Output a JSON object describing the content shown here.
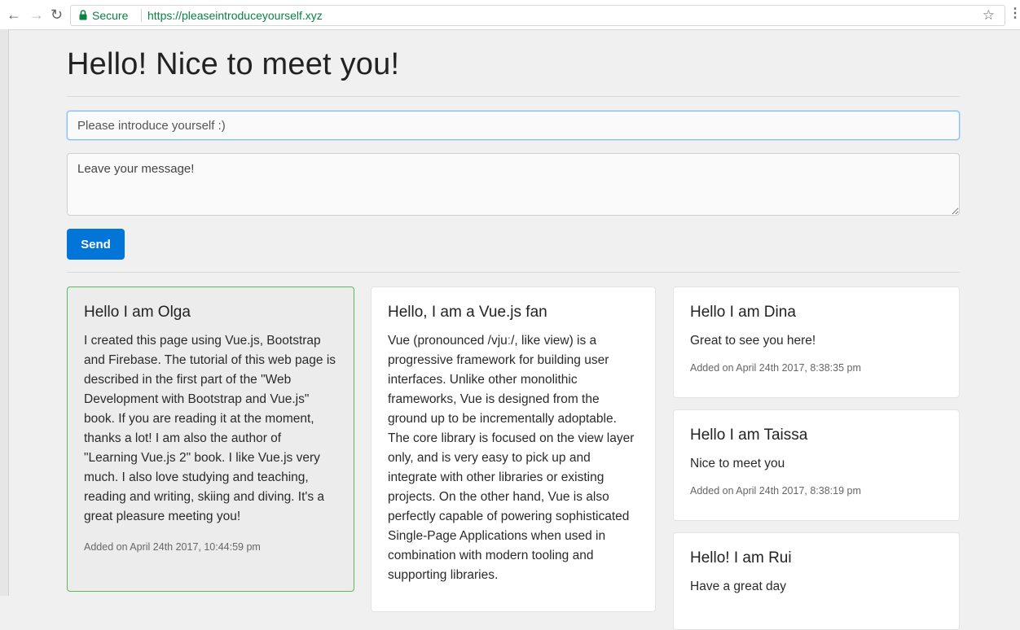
{
  "browser": {
    "secure_label": "Secure",
    "url": "https://pleaseintroduceyourself.xyz"
  },
  "page": {
    "title": "Hello! Nice to meet you!"
  },
  "form": {
    "name_placeholder": "Please introduce yourself :)",
    "message_placeholder": "Leave your message!",
    "send_label": "Send"
  },
  "cards": [
    {
      "title": "Hello I am Olga",
      "text": "I created this page using Vue.js, Bootstrap and Firebase. The tutorial of this web page is described in the first part of the \"Web Development with Bootstrap and Vue.js\" book. If you are reading it at the moment, thanks a lot! I am also the author of \"Learning Vue.js 2\" book. I like Vue.js very much. I also love studying and teaching, reading and writing, skiing and diving. It's a great pleasure meeting you!",
      "added": "Added on April 24th 2017, 10:44:59 pm"
    },
    {
      "title": "Hello, I am a Vue.js fan",
      "text": "Vue (pronounced /vjuː/, like view) is a progressive framework for building user interfaces. Unlike other monolithic frameworks, Vue is designed from the ground up to be incrementally adoptable. The core library is focused on the view layer only, and is very easy to pick up and integrate with other libraries or existing projects. On the other hand, Vue is also perfectly capable of powering sophisticated Single-Page Applications when used in combination with modern tooling and supporting libraries."
    },
    {
      "title": "Hello I am Dina",
      "text": "Great to see you here!",
      "added": "Added on April 24th 2017, 8:38:35 pm"
    },
    {
      "title": "Hello I am Taissa",
      "text": "Nice to meet you",
      "added": "Added on April 24th 2017, 8:38:19 pm"
    },
    {
      "title": "Hello! I am Rui",
      "text": "Have a great day"
    }
  ]
}
